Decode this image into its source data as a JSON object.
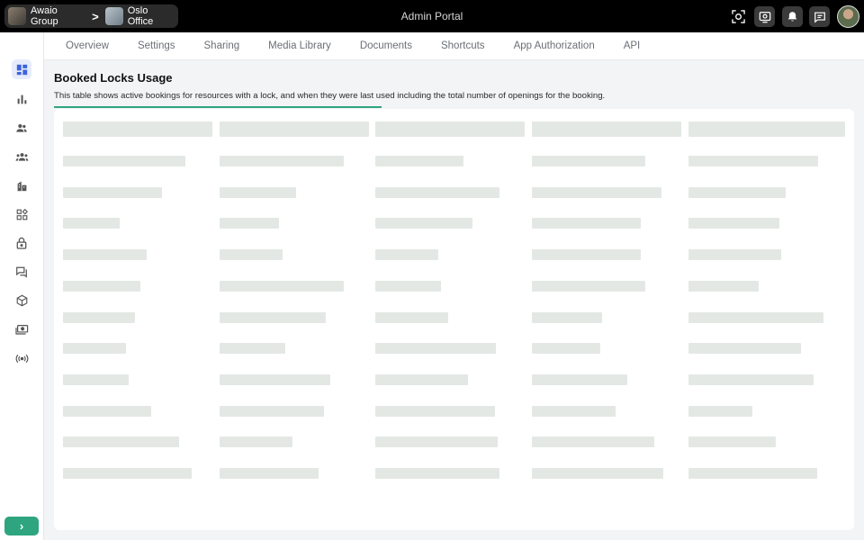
{
  "topbar": {
    "breadcrumb": [
      {
        "label": "Awaio Group",
        "icon": "organization-thumbnail"
      },
      {
        "label": "Oslo Office",
        "icon": "building-thumbnail"
      }
    ],
    "separator": ">",
    "title": "Admin Portal",
    "actions": [
      "scan-icon",
      "display-icon",
      "bell-icon",
      "chat-icon"
    ]
  },
  "sidebar": {
    "items": [
      "dashboard-icon",
      "analytics-icon",
      "users-icon",
      "groups-icon",
      "buildings-icon",
      "apps-icon",
      "lock-icon",
      "messages-icon",
      "package-icon",
      "payments-icon",
      "broadcast-icon"
    ],
    "active": "dashboard-icon",
    "expand_label": "›"
  },
  "tabs": [
    "Overview",
    "Settings",
    "Sharing",
    "Media Library",
    "Documents",
    "Shortcuts",
    "App Authorization",
    "API"
  ],
  "main": {
    "title": "Booked Locks Usage",
    "description": "This table shows active bookings for resources with a lock, and when they were last used including the total number of openings for the booking.",
    "loading_progress": 0.41
  },
  "table": {
    "state": "loading-skeleton",
    "columns": 5,
    "rows": 11,
    "row_fill": [
      [
        0.82,
        0.83,
        0.59,
        0.76,
        0.83
      ],
      [
        0.66,
        0.51,
        0.83,
        0.87,
        0.62
      ],
      [
        0.38,
        0.4,
        0.65,
        0.73,
        0.58
      ],
      [
        0.56,
        0.42,
        0.42,
        0.73,
        0.59
      ],
      [
        0.52,
        0.83,
        0.44,
        0.76,
        0.45
      ],
      [
        0.48,
        0.71,
        0.49,
        0.47,
        0.86
      ],
      [
        0.42,
        0.44,
        0.81,
        0.46,
        0.72
      ],
      [
        0.44,
        0.74,
        0.62,
        0.64,
        0.8
      ],
      [
        0.59,
        0.7,
        0.8,
        0.56,
        0.41
      ],
      [
        0.78,
        0.49,
        0.82,
        0.82,
        0.56
      ],
      [
        0.86,
        0.66,
        0.83,
        0.88,
        0.82
      ]
    ]
  },
  "colors": {
    "accent": "#2fa57f",
    "skeleton": "#e4e8e5",
    "topbar": "#000000"
  }
}
